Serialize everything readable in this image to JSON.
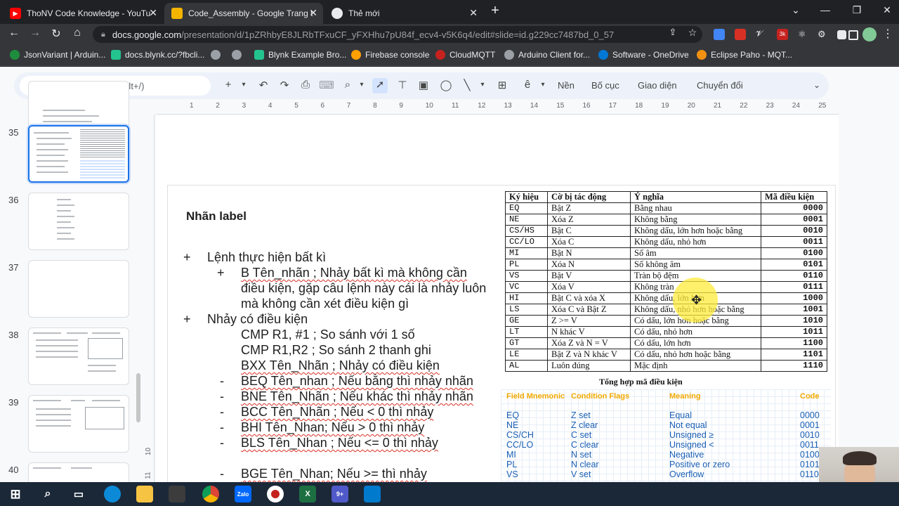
{
  "browser": {
    "tabs": [
      {
        "title": "ThoNV Code Knowledge - YouTu",
        "icon": "youtube-icon",
        "active": false
      },
      {
        "title": "Code_Assembly - Google Trang t",
        "icon": "google-slides-icon",
        "active": true
      },
      {
        "title": "Thẻ mới",
        "icon": "chrome-icon",
        "active": false
      }
    ],
    "new_tab_label": "+",
    "url_domain": "docs.google.com",
    "url_path": "/presentation/d/1pZRhbyE8JLRbTFxuCF_yFXHhu7pU84f_ecv4-v5K6q4/edit#slide=id.g229cc7487bd_0_57",
    "bookmarks": [
      "JsonVariant | Arduin...",
      "docs.blynk.cc/?fbcli...",
      "",
      "",
      "Blynk Example Bro...",
      "Firebase console",
      "CloudMQTT",
      "Arduino Client for...",
      "Software - OneDrive",
      "Eclipse Paho - MQT..."
    ],
    "ext_badge": "3k"
  },
  "slides_app": {
    "menu_search_placeholder": "Tìm kiếm trong menu (Alt+/)",
    "toolbar_text_buttons": [
      "Nền",
      "Bố cục",
      "Giao diện",
      "Chuyển đổi"
    ],
    "ruler_numbers": [
      "1",
      "2",
      "3",
      "4",
      "5",
      "6",
      "7",
      "8",
      "9",
      "10",
      "11",
      "12",
      "13",
      "14",
      "15",
      "16",
      "17",
      "18",
      "19",
      "20",
      "21",
      "22",
      "23",
      "24",
      "25"
    ],
    "vruler_numbers": [
      "10",
      "11"
    ],
    "slide_numbers": [
      "35",
      "36",
      "37",
      "38",
      "39",
      "40"
    ],
    "selected_slide": "35"
  },
  "slide": {
    "title": "Nhãn label",
    "lines": [
      {
        "bullet": "+",
        "text": "Lệnh thực hiện bất kì"
      },
      {
        "bullet": "+",
        "text": "B  Tên_nhãn  ; Nhảy bất kì mà không cần"
      },
      {
        "bullet": "",
        "text": "điều kiện, gặp câu lệnh này cái là nhảy luôn"
      },
      {
        "bullet": "",
        "text": "mà không cần xét điều kiện gì"
      },
      {
        "bullet": "+",
        "text": "Nhảy có điều kiện"
      },
      {
        "bullet": "",
        "text": "CMP R1, #1  ; So sánh với 1 số"
      },
      {
        "bullet": "",
        "text": "CMP R1,R2  ; So sánh 2 thanh ghi"
      },
      {
        "bullet": "",
        "text": "BXX Tên_Nhãn  ; Nhảy có điều kiện"
      },
      {
        "bullet": "-",
        "text": "BEQ Tên_nhan ; Nếu bằng thì nhảy nhãn"
      },
      {
        "bullet": "-",
        "text": "BNE Tên_Nhãn ; Nếu khác thì nhảy nhãn"
      },
      {
        "bullet": "-",
        "text": "BCC Tên_Nhãn ; Nếu < 0 thì nhảy"
      },
      {
        "bullet": "-",
        "text": "BHI Tên_Nhan; Nếu > 0 thì nhảy"
      },
      {
        "bullet": "-",
        "text": "BLS Tên_Nhan ; Nếu <= 0 thì nhảy"
      },
      {
        "bullet": "-",
        "text": "BGE Tên_Nhan; Nếu >= thì nhảy"
      }
    ],
    "condition_table": {
      "headers": [
        "Ký hiệu",
        "Cờ bị tác động",
        "Ý nghĩa",
        "Mã điều kiện"
      ],
      "rows": [
        [
          "EQ",
          "Bật Z",
          "Bằng nhau",
          "0000"
        ],
        [
          "NE",
          "Xóa Z",
          "Không bằng",
          "0001"
        ],
        [
          "CS/HS",
          "Bật C",
          "Không dấu, lớn hơn hoặc bằng",
          "0010"
        ],
        [
          "CC/LO",
          "Xóa C",
          "Không dấu, nhỏ hơn",
          "0011"
        ],
        [
          "MI",
          "Bật N",
          "Số âm",
          "0100"
        ],
        [
          "PL",
          "Xóa N",
          "Số không âm",
          "0101"
        ],
        [
          "VS",
          "Bật V",
          "Tràn bộ đệm",
          "0110"
        ],
        [
          "VC",
          "Xóa V",
          "Không tràn",
          "0111"
        ],
        [
          "HI",
          "Bật C và xóa X",
          "Không dấu, lớn hơn",
          "1000"
        ],
        [
          "LS",
          "Xóa C và Bật Z",
          "Không dấu, nhỏ hơn hoặc bằng",
          "1001"
        ],
        [
          "GE",
          "Z >= V",
          "Có dấu, lớn hơn hoặc bằng",
          "1010"
        ],
        [
          "LT",
          "N khác V",
          "Có dấu, nhỏ hơn",
          "1011"
        ],
        [
          "GT",
          "Xóa Z và N = V",
          "Có dấu, lớn hơn",
          "1100"
        ],
        [
          "LE",
          "Bật Z và N khác V",
          "Có dấu, nhỏ hơn hoặc bằng",
          "1101"
        ],
        [
          "AL",
          "Luôn đúng",
          "Mặc định",
          "1110"
        ]
      ],
      "caption": "Tổng hợp mã điều kiện"
    },
    "mnemonic_table": {
      "headers": [
        "Field Mnemonic",
        "Condition Flags",
        "Meaning",
        "Code"
      ],
      "rows": [
        [
          "EQ",
          "Z set",
          "Equal",
          "0000"
        ],
        [
          "NE",
          "Z clear",
          "Not equal",
          "0001"
        ],
        [
          "CS/CH",
          "C set",
          "Unsigned ≥",
          "0010"
        ],
        [
          "CC/LO",
          "C clear",
          "Unsigned <",
          "0011"
        ],
        [
          "MI",
          "N set",
          "Negative",
          "0100"
        ],
        [
          "PL",
          "N clear",
          " Positive or zero",
          "0101"
        ],
        [
          "VS",
          "V set",
          "Overflow",
          "0110"
        ]
      ]
    }
  },
  "taskbar": {
    "apps": [
      "windows-start",
      "search",
      "task-view",
      "edge",
      "file-explorer",
      "store",
      "chrome",
      "zalo",
      "obs",
      "excel",
      "teams",
      "vscode"
    ],
    "zalo_label": "Zalo",
    "excel_label": "X",
    "teams_badge": "9+"
  }
}
